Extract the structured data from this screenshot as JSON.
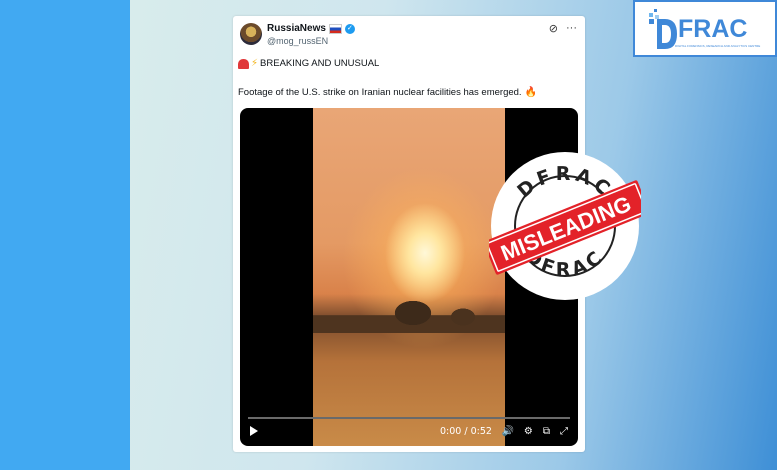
{
  "tweet": {
    "account_name": "RussiaNews",
    "handle": "@mog_russEN",
    "headline": "BREAKING AND UNUSUAL",
    "body": "Footage of the U.S. strike on Iranian nuclear facilities has emerged."
  },
  "video": {
    "time": "0:00 / 0:52",
    "progress_fraction": 0.0
  },
  "stamp": {
    "label": "MISLEADING",
    "top_text": "DFRAC",
    "bottom_text": "DFRAC",
    "color": "#e32229"
  },
  "logo": {
    "wordmark": "FRAC",
    "tagline": "DIGITAL FORENSICS, RESEARCH AND ANALYTICS CENTRE",
    "color": "#3f88d8"
  }
}
